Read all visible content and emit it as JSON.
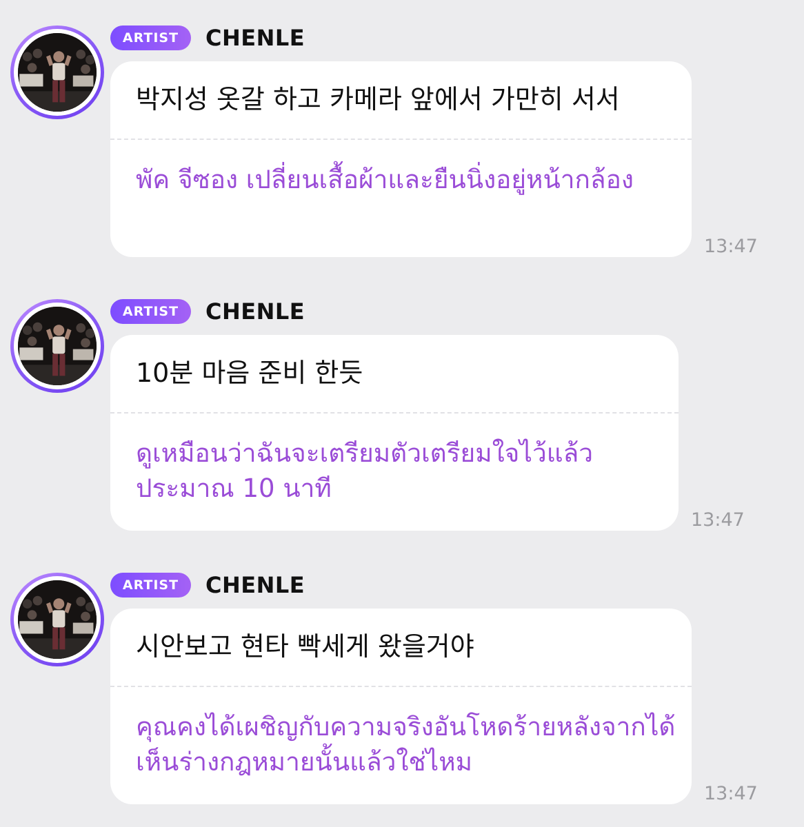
{
  "messages": [
    {
      "badge": "ARTIST",
      "name": "CHENLE",
      "original": "박지성 옷갈 하고 카메라 앞에서 가만히 서서",
      "translation": "พัค จีซอง เปลี่ยนเสื้อผ้าและยืนนิ่งอยู่หน้ากล้อง",
      "time": "13:47"
    },
    {
      "badge": "ARTIST",
      "name": "CHENLE",
      "original": "10분 마음 준비 한듯",
      "translation": "ดูเหมือนว่าฉันจะเตรียมตัวเตรียมใจไว้แล้วประมาณ 10 นาที",
      "time": "13:47"
    },
    {
      "badge": "ARTIST",
      "name": "CHENLE",
      "original": "시안보고 현타 빡세게 왔을거야",
      "translation": "คุณคงได้เผชิญกับความจริงอันโหดร้ายหลังจากได้เห็นร่างกฎหมายนั้นแล้วใช่ไหม",
      "time": "13:47"
    }
  ],
  "colors": {
    "background": "#ececee",
    "bubble": "#ffffff",
    "translation_text": "#9a4cd7",
    "badge_gradient_start": "#7d4dff",
    "badge_gradient_end": "#a462f5",
    "timestamp": "#9b9b9f"
  },
  "icons": {
    "avatar": "artist-profile-photo"
  }
}
